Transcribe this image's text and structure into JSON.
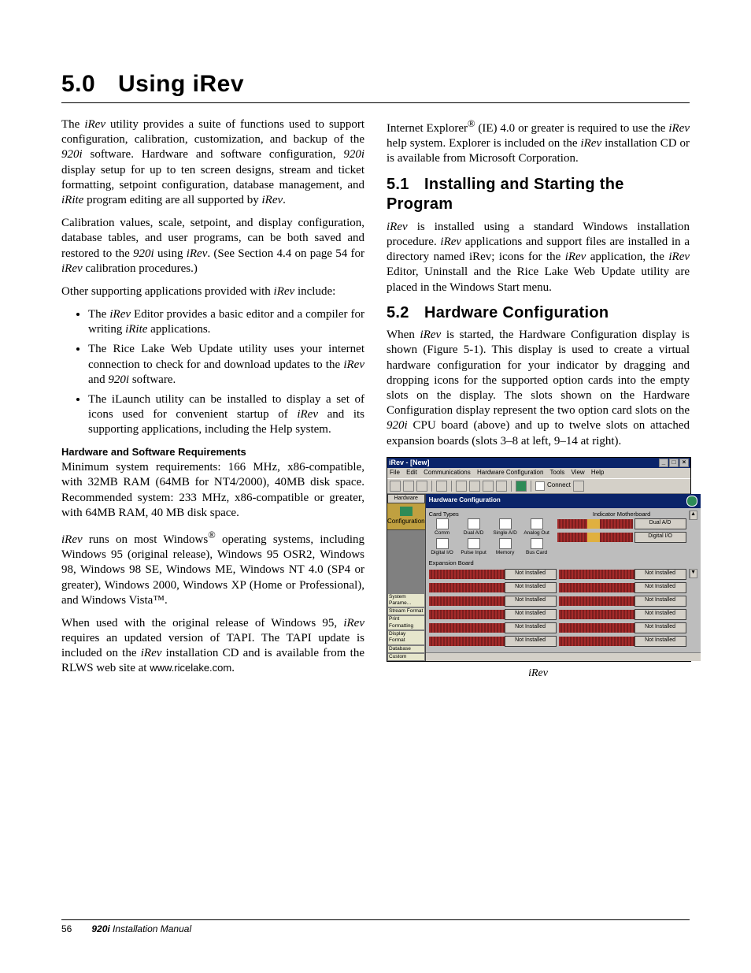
{
  "title": {
    "num": "5.0",
    "text": "Using iRev"
  },
  "left": {
    "p1_a": "The ",
    "p1_b": "iRev",
    "p1_c": " utility provides a suite of functions used to support configuration, calibration, customization, and backup of the ",
    "p1_d": "920i",
    "p1_e": " software. Hardware and software configuration, ",
    "p1_f": "920i",
    "p1_g": " display setup for up to ten screen designs, stream and ticket formatting, setpoint configuration, database management, and ",
    "p1_h": "iRite",
    "p1_i": " program editing are all supported by ",
    "p1_j": "iRev",
    "p1_k": ".",
    "p2_a": "Calibration values, scale, setpoint, and display configuration, database tables, and user programs, can be both saved and restored to the ",
    "p2_b": "920i",
    "p2_c": " using ",
    "p2_d": "iRev",
    "p2_e": ". (See Section 4.4 on page 54 for ",
    "p2_f": "iRev",
    "p2_g": " calibration procedures.)",
    "p3_a": "Other supporting applications provided with ",
    "p3_b": "iRev",
    "p3_c": " include:",
    "li1_a": "The ",
    "li1_b": "iRev",
    "li1_c": " Editor provides  a basic editor and a compiler for writing ",
    "li1_d": "iRite",
    "li1_e": " applications.",
    "li2_a": "The Rice Lake Web Update utility uses your internet connection to check for and download updates to the ",
    "li2_b": "iRev",
    "li2_c": " and ",
    "li2_d": "920i",
    "li2_e": " software.",
    "li3_a": "The iLaunch utility can be installed to display a set of icons used for convenient startup of ",
    "li3_b": "iRev",
    "li3_c": " and its supporting applications, including the Help system.",
    "sub1": "Hardware and Software Requirements",
    "p4": "Minimum system requirements: 166 MHz, x86-compatible, with 32MB RAM (64MB for NT4/2000), 40MB disk space. Recommended system: 233 MHz, x86-compatible or greater, with 64MB RAM, 40 MB disk space.",
    "p5_a": "iRev",
    "p5_b": " runs on most Windows",
    "p5_reg": "®",
    "p5_c": " operating systems, including Windows 95 (original release), Windows 95 OSR2, Windows 98, Windows 98 SE, Windows ME, Windows NT 4.0 (SP4 or greater), Windows 2000, Windows XP (Home or Professional), and Windows Vista™.",
    "p6_a": "When used with the original release of Windows 95, ",
    "p6_b": "iRev",
    "p6_c": " requires an updated version of TAPI. The TAPI update is included on the ",
    "p6_d": "iRev",
    "p6_e": " installation CD and is available from the RLWS web site at ",
    "p6_url": "www.ricelake.com",
    "p6_f": ".",
    "p7_a": "Internet Explorer",
    "p7_b": " (IE) 4.0 or greater is required to use the ",
    "p7_c": "iRev",
    "p7_d": " help system. Explorer is included on the ",
    "p7_e": "iRev",
    "p7_f": " installation CD or is available from Microsoft Corporation."
  },
  "right": {
    "s1_num": "5.1",
    "s1_title": "Installing and Starting the Program",
    "s1_p_a": "iRev",
    "s1_p_b": " is installed using a standard Windows installation procedure. ",
    "s1_p_c": "iRev",
    "s1_p_d": " applications and support files are installed in a directory named iRev; icons for the ",
    "s1_p_e": "iRev",
    "s1_p_f": " application, the ",
    "s1_p_g": "iRev",
    "s1_p_h": " Editor, Uninstall and the Rice Lake Web Update utility are placed in the Windows Start menu.",
    "s2_num": "5.2",
    "s2_title": "Hardware Configuration",
    "s2_p_a": "When ",
    "s2_p_b": "iRev",
    "s2_p_c": " is started, the Hardware Configuration display is shown (Figure 5-1). This display is used to create a virtual hardware configuration for your indicator by dragging and dropping icons for the supported option cards into the empty slots on the display. The slots shown on the Hardware Configuration display represent the two option card slots on the ",
    "s2_p_d": "920i",
    "s2_p_e": " CPU board (above) and up to twelve slots on attached expansion boards (slots 3–8 at left, 9–14 at right).",
    "fig_caption": "iRev"
  },
  "screenshot": {
    "title": "iRev - [New]",
    "menu": [
      "File",
      "Edit",
      "Communications",
      "Hardware Configuration",
      "Tools",
      "View",
      "Help"
    ],
    "toolbar_connect": "Connect",
    "sidebar": {
      "top_btn": "Hardware",
      "selected": "Configuration",
      "bottom": [
        "System Parame...",
        "Stream Format",
        "Print Formatting",
        "Display Format",
        "Database",
        "Custom"
      ]
    },
    "content_title": "Hardware Configuration",
    "card_types_label": "Card Types",
    "card_types": [
      [
        "Comm",
        "Dual A/D",
        "Single A/D",
        "Analog Out"
      ],
      [
        "Digital I/O",
        "Pulse Input",
        "Memory",
        "Bus Card"
      ]
    ],
    "expansion_label": "Expansion Board",
    "mb_label": "Indicator Motherboard",
    "mb_buttons": [
      "Dual A/D",
      "Digital I/O"
    ],
    "not_installed": "Not Installed"
  },
  "footer": {
    "page": "56",
    "doc_bold": "920i",
    "doc_rest": " Installation Manual"
  }
}
